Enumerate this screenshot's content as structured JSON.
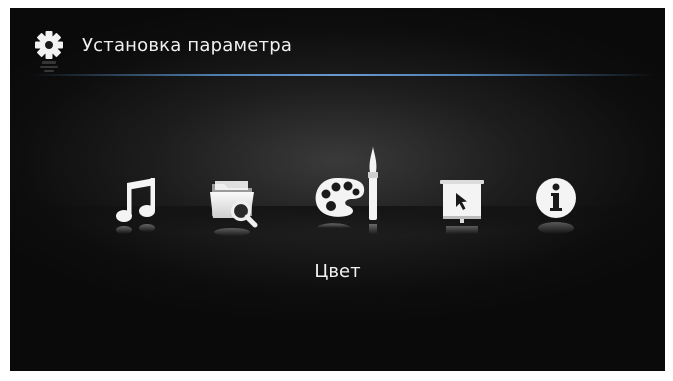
{
  "header": {
    "title": "Установка параметра",
    "icon": "gear-icon"
  },
  "menu": {
    "items": [
      {
        "icon": "music-note-icon"
      },
      {
        "icon": "folder-search-icon"
      },
      {
        "icon": "palette-brush-icon",
        "selected": true
      },
      {
        "icon": "slideshow-screen-icon"
      },
      {
        "icon": "info-icon"
      }
    ],
    "selected_label": "Цвет"
  },
  "colors": {
    "background": "#0d0d0d",
    "accent_line": "#5a8ac0",
    "text": "#f0f0f0"
  }
}
